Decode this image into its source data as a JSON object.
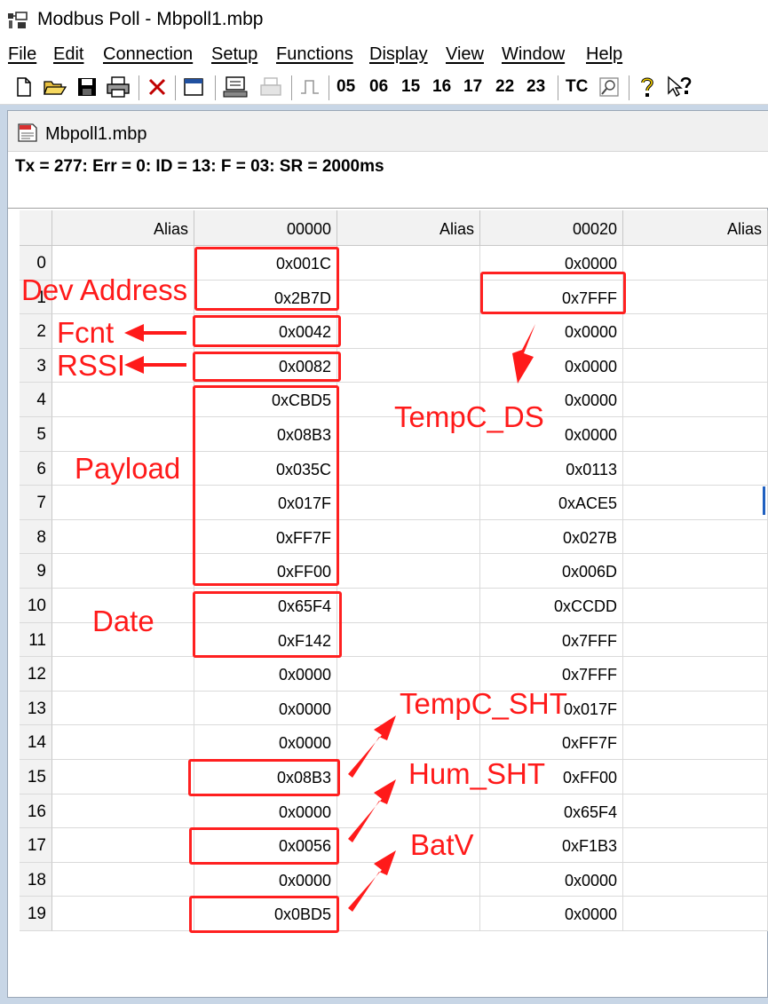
{
  "window": {
    "title": "Modbus Poll - Mbpoll1.mbp"
  },
  "menu": [
    "File",
    "Edit",
    "Connection",
    "Setup",
    "Functions",
    "Display",
    "View",
    "Window",
    "Help"
  ],
  "toolbar": {
    "function_codes": [
      "05",
      "06",
      "15",
      "16",
      "17",
      "22",
      "23"
    ],
    "tc_label": "TC"
  },
  "document": {
    "title": "Mbpoll1.mbp",
    "status": "Tx = 277: Err = 0: ID = 13: F = 03: SR = 2000ms"
  },
  "grid": {
    "headers": [
      "Alias",
      "00000",
      "Alias",
      "00020",
      "Alias"
    ],
    "row_numbers": [
      "0",
      "1",
      "2",
      "3",
      "4",
      "5",
      "6",
      "7",
      "8",
      "9",
      "10",
      "11",
      "12",
      "13",
      "14",
      "15",
      "16",
      "17",
      "18",
      "19"
    ],
    "col_00000": [
      "0x001C",
      "0x2B7D",
      "0x0042",
      "0x0082",
      "0xCBD5",
      "0x08B3",
      "0x035C",
      "0x017F",
      "0xFF7F",
      "0xFF00",
      "0x65F4",
      "0xF142",
      "0x0000",
      "0x0000",
      "0x0000",
      "0x08B3",
      "0x0000",
      "0x0056",
      "0x0000",
      "0x0BD5"
    ],
    "col_00020": [
      "0x0000",
      "0x7FFF",
      "0x0000",
      "0x0000",
      "0x0000",
      "0x0000",
      "0x0113",
      "0xACE5",
      "0x027B",
      "0x006D",
      "0xCCDD",
      "0x7FFF",
      "0x7FFF",
      "0x017F",
      "0xFF7F",
      "0xFF00",
      "0x65F4",
      "0xF1B3",
      "0x0000",
      "0x0000"
    ]
  },
  "annotations": {
    "dev_address": "Dev Address",
    "fcnt": "Fcnt",
    "rssi": "RSSI",
    "payload": "Payload",
    "date": "Date",
    "tempc_ds": "TempC_DS",
    "tempc_sht": "TempC_SHT",
    "hum_sht": "Hum_SHT",
    "batv": "BatV",
    "color": "#ff1a1a"
  }
}
